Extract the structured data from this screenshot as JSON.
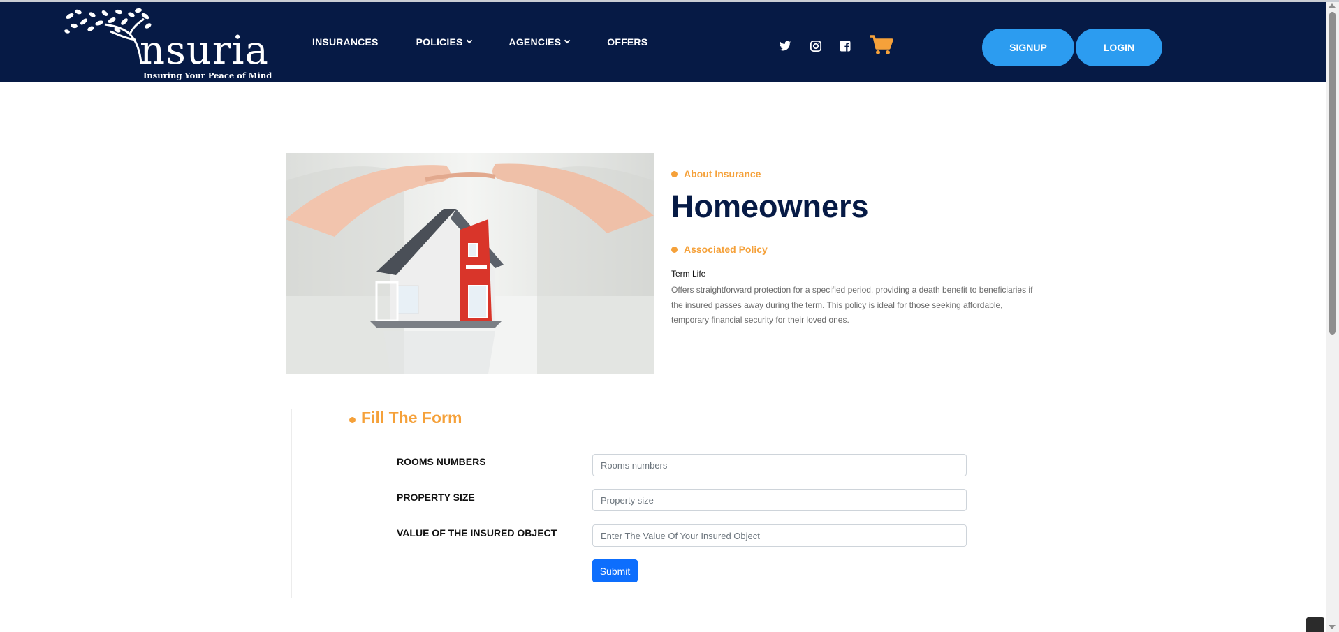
{
  "brand": {
    "name": "nsuria",
    "tagline": "Insuring Your Peace of Mind"
  },
  "nav": {
    "items": [
      {
        "label": "INSURANCES"
      },
      {
        "label": "POLICIES"
      },
      {
        "label": "AGENCIES"
      },
      {
        "label": "OFFERS"
      }
    ]
  },
  "social": {
    "icons": [
      "twitter-icon",
      "instagram-icon",
      "facebook-icon"
    ],
    "cart_icon": "cart-icon"
  },
  "header": {
    "signup_label": "SIGNUP",
    "login_label": "LOGIN"
  },
  "colors": {
    "navy": "#061a45",
    "accent_orange": "#f5a13a",
    "header_button": "#2c9cf0",
    "submit_button": "#0d6efd"
  },
  "hero": {
    "eyebrow": "About Insurance",
    "title": "Homeowners",
    "policy_eyebrow": "Associated Policy",
    "policy_name": "Term Life",
    "policy_description": "Offers straightforward protection for a specified period, providing a death benefit to beneficiaries if the insured passes away during the term. This policy is ideal for those seeking affordable, temporary financial security for their loved ones."
  },
  "form": {
    "title": "Fill The Form",
    "fields": [
      {
        "label": "ROOMS NUMBERS",
        "value": "",
        "placeholder": "Rooms numbers"
      },
      {
        "label": "PROPERTY SIZE",
        "value": "",
        "placeholder": "Property size"
      },
      {
        "label": "VALUE OF THE INSURED OBJECT",
        "value": "",
        "placeholder": "Enter The Value Of Your Insured Object"
      }
    ],
    "submit_label": "Submit"
  }
}
